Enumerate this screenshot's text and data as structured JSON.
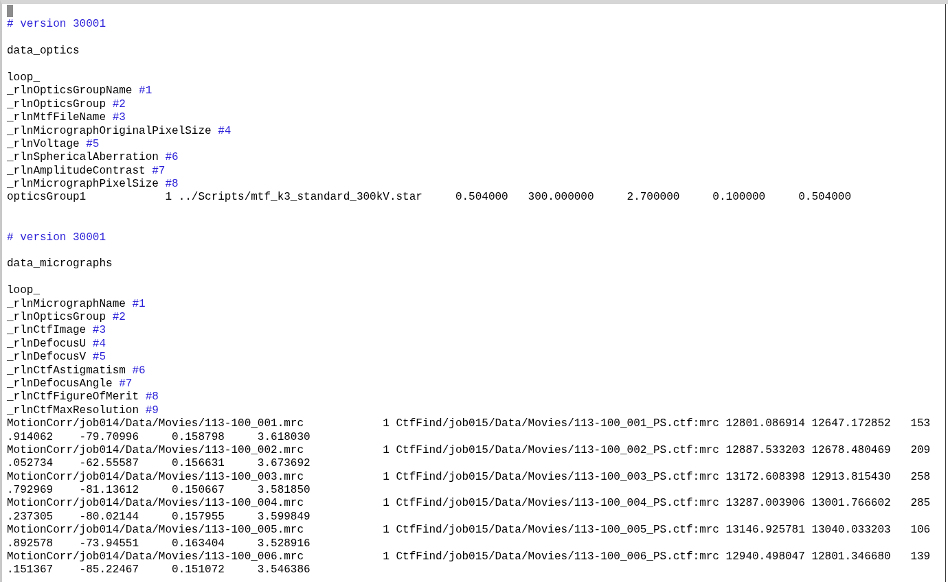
{
  "lines": [
    {
      "kind": "cursor"
    },
    {
      "kind": "comment",
      "text": "# version 30001"
    },
    {
      "kind": "blank"
    },
    {
      "kind": "text",
      "text": "data_optics"
    },
    {
      "kind": "blank"
    },
    {
      "kind": "text",
      "text": "loop_"
    },
    {
      "kind": "field",
      "name": "_rlnOpticsGroupName",
      "index": "#1"
    },
    {
      "kind": "field",
      "name": "_rlnOpticsGroup",
      "index": "#2"
    },
    {
      "kind": "field",
      "name": "_rlnMtfFileName",
      "index": "#3"
    },
    {
      "kind": "field",
      "name": "_rlnMicrographOriginalPixelSize",
      "index": "#4"
    },
    {
      "kind": "field",
      "name": "_rlnVoltage",
      "index": "#5"
    },
    {
      "kind": "field",
      "name": "_rlnSphericalAberration",
      "index": "#6"
    },
    {
      "kind": "field",
      "name": "_rlnAmplitudeContrast",
      "index": "#7"
    },
    {
      "kind": "field",
      "name": "_rlnMicrographPixelSize",
      "index": "#8"
    },
    {
      "kind": "text",
      "text": "opticsGroup1            1 ../Scripts/mtf_k3_standard_300kV.star     0.504000   300.000000     2.700000     0.100000     0.504000"
    },
    {
      "kind": "blank"
    },
    {
      "kind": "blank"
    },
    {
      "kind": "comment",
      "text": "# version 30001"
    },
    {
      "kind": "blank"
    },
    {
      "kind": "text",
      "text": "data_micrographs"
    },
    {
      "kind": "blank"
    },
    {
      "kind": "text",
      "text": "loop_"
    },
    {
      "kind": "field",
      "name": "_rlnMicrographName",
      "index": "#1"
    },
    {
      "kind": "field",
      "name": "_rlnOpticsGroup",
      "index": "#2"
    },
    {
      "kind": "field",
      "name": "_rlnCtfImage",
      "index": "#3"
    },
    {
      "kind": "field",
      "name": "_rlnDefocusU",
      "index": "#4"
    },
    {
      "kind": "field",
      "name": "_rlnDefocusV",
      "index": "#5"
    },
    {
      "kind": "field",
      "name": "_rlnCtfAstigmatism",
      "index": "#6"
    },
    {
      "kind": "field",
      "name": "_rlnDefocusAngle",
      "index": "#7"
    },
    {
      "kind": "field",
      "name": "_rlnCtfFigureOfMerit",
      "index": "#8"
    },
    {
      "kind": "field",
      "name": "_rlnCtfMaxResolution",
      "index": "#9"
    },
    {
      "kind": "text",
      "text": "MotionCorr/job014/Data/Movies/113-100_001.mrc            1 CtfFind/job015/Data/Movies/113-100_001_PS.ctf:mrc 12801.086914 12647.172852   153"
    },
    {
      "kind": "text",
      "text": ".914062    -79.70996     0.158798     3.618030"
    },
    {
      "kind": "text",
      "text": "MotionCorr/job014/Data/Movies/113-100_002.mrc            1 CtfFind/job015/Data/Movies/113-100_002_PS.ctf:mrc 12887.533203 12678.480469   209"
    },
    {
      "kind": "text",
      "text": ".052734    -62.55587     0.156631     3.673692"
    },
    {
      "kind": "text",
      "text": "MotionCorr/job014/Data/Movies/113-100_003.mrc            1 CtfFind/job015/Data/Movies/113-100_003_PS.ctf:mrc 13172.608398 12913.815430   258"
    },
    {
      "kind": "text",
      "text": ".792969    -81.13612     0.150667     3.581850"
    },
    {
      "kind": "text",
      "text": "MotionCorr/job014/Data/Movies/113-100_004.mrc            1 CtfFind/job015/Data/Movies/113-100_004_PS.ctf:mrc 13287.003906 13001.766602   285"
    },
    {
      "kind": "text",
      "text": ".237305    -80.02144     0.157955     3.599849"
    },
    {
      "kind": "text",
      "text": "MotionCorr/job014/Data/Movies/113-100_005.mrc            1 CtfFind/job015/Data/Movies/113-100_005_PS.ctf:mrc 13146.925781 13040.033203   106"
    },
    {
      "kind": "text",
      "text": ".892578    -73.94551     0.163404     3.528916"
    },
    {
      "kind": "text",
      "text": "MotionCorr/job014/Data/Movies/113-100_006.mrc            1 CtfFind/job015/Data/Movies/113-100_006_PS.ctf:mrc 12940.498047 12801.346680   139"
    },
    {
      "kind": "text",
      "text": ".151367    -85.22467     0.151072     3.546386"
    }
  ]
}
